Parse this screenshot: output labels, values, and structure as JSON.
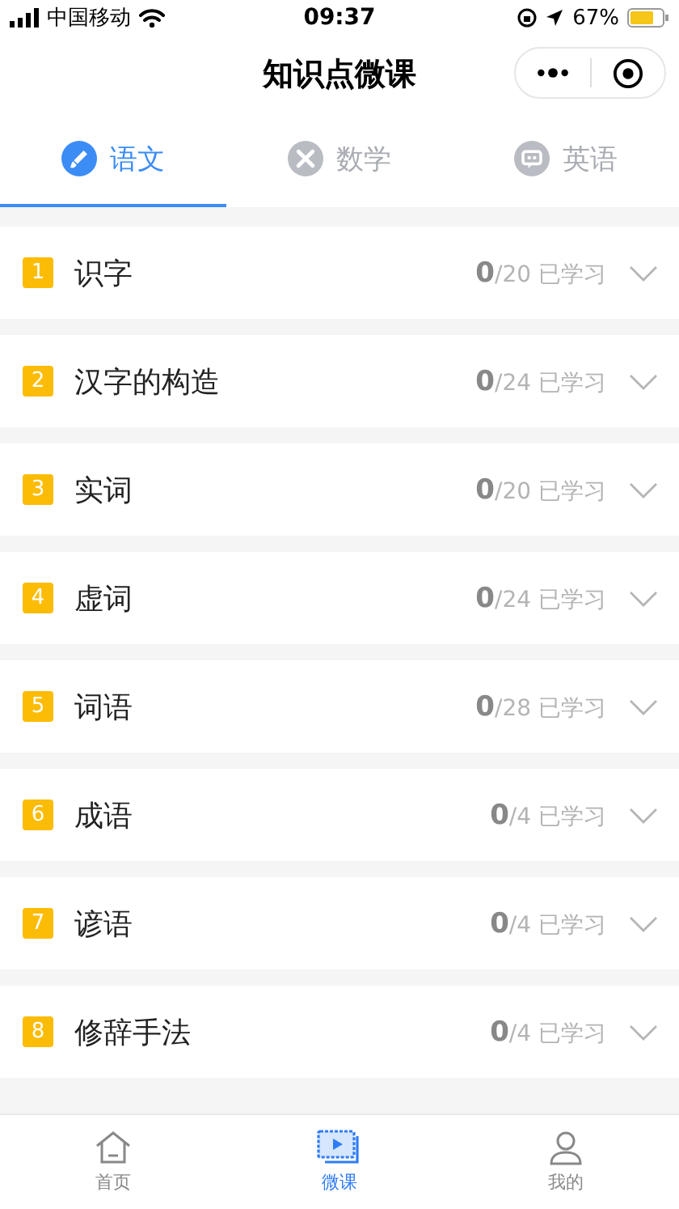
{
  "status_bar": {
    "carrier": "中国移动",
    "time": "09:37",
    "battery_text": "67%"
  },
  "nav": {
    "title": "知识点微课"
  },
  "tabs": [
    {
      "label": "语文",
      "kind": "brush",
      "selected": true
    },
    {
      "label": "数学",
      "kind": "math",
      "selected": false
    },
    {
      "label": "英语",
      "kind": "chat",
      "selected": false
    }
  ],
  "lessons": [
    {
      "number": "1",
      "title": "识字",
      "progress": "**0**/20 已学习",
      "expanded": false
    },
    {
      "number": "2",
      "title": "汉字的构造",
      "progress": "**0**/24 已学习",
      "expanded": false
    },
    {
      "number": "3",
      "title": "实词",
      "progress": "**0**/20 已学习",
      "expanded": false
    },
    {
      "number": "4",
      "title": "虚词",
      "progress": "**0**/24 已学习",
      "expanded": false
    },
    {
      "number": "5",
      "title": "词语",
      "progress": "**0**/28 已学习",
      "expanded": false
    },
    {
      "number": "6",
      "title": "成语",
      "progress": "**0**/4 已学习",
      "expanded": false
    },
    {
      "number": "7",
      "title": "谚语",
      "progress": "**0**/4 已学习",
      "expanded": false
    },
    {
      "number": "8",
      "title": "修辞手法",
      "progress": "**0**/4 已学习",
      "expanded": false
    }
  ],
  "tab_bar": [
    {
      "label": "首页",
      "kind": "home",
      "selected": false
    },
    {
      "label": "微课",
      "kind": "video",
      "selected": true
    },
    {
      "label": "我的",
      "kind": "person",
      "selected": false
    }
  ]
}
